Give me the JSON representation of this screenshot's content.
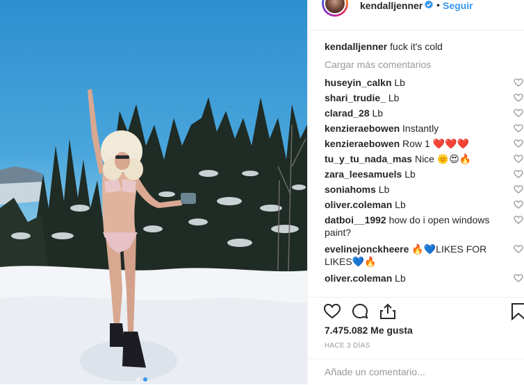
{
  "post": {
    "username": "kendalljenner",
    "separator": "•",
    "follow_label": "Seguir",
    "caption_user": "kendalljenner",
    "caption_text": "fuck it's cold",
    "load_more": "Cargar más comentarios"
  },
  "comments": [
    {
      "user": "huseyin_calkn",
      "text": "Lb"
    },
    {
      "user": "shari_trudie_",
      "text": "Lb"
    },
    {
      "user": "clarad_28",
      "text": "Lb"
    },
    {
      "user": "kenzieraebowen",
      "text": "Instantly"
    },
    {
      "user": "kenzieraebowen",
      "text": "Row 1 ❤️❤️❤️"
    },
    {
      "user": "tu_y_tu_nada_mas",
      "text": "Nice 🌞😍🔥"
    },
    {
      "user": "zara_leesamuels",
      "text": "Lb"
    },
    {
      "user": "soniahoms",
      "text": "Lb"
    },
    {
      "user": "oliver.coleman",
      "text": "Lb"
    },
    {
      "user": "datboi__1992",
      "text": "how do i open windows paint?"
    },
    {
      "user": "evelinejonckheere",
      "text": "🔥💙LIKES FOR LIKES💙🔥"
    },
    {
      "user": "oliver.coleman",
      "text": "Lb"
    }
  ],
  "likes_text": "7.475.082 Me gusta",
  "time_text": "HACE 3 DÍAS",
  "add_comment_placeholder": "Añade un comentario...",
  "colors": {
    "accent": "#3897f0",
    "muted": "#999999",
    "text": "#262626",
    "border": "#efefef"
  },
  "icons": {
    "verified": "verified-badge-icon",
    "like": "heart-outline-icon",
    "comment": "comment-bubble-icon",
    "share": "share-icon",
    "save": "bookmark-icon"
  },
  "carousel": {
    "count": 2,
    "active_index": 1
  }
}
